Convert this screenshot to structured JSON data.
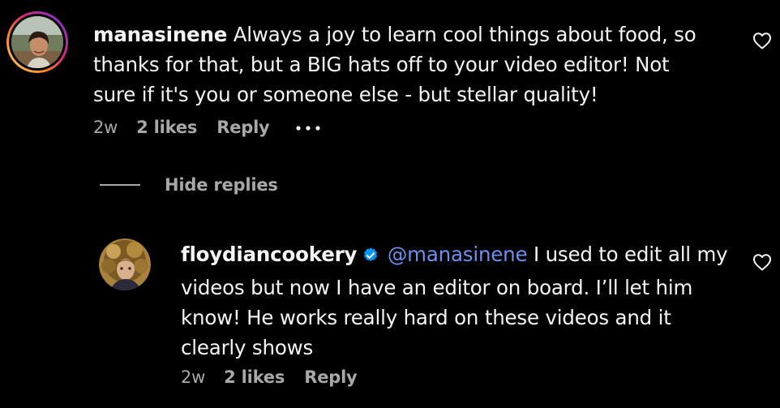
{
  "comments": [
    {
      "username": "manasinene",
      "text_lines": [
        "Always a joy to learn cool things about food, so",
        "thanks for that, but a BIG hats off to your video editor! Not",
        "sure if it's you or someone else - but stellar quality!"
      ],
      "age": "2w",
      "likes": "2 likes",
      "reply_label": "Reply",
      "more_label": "•••",
      "avatar_icon": "profile-photo-with-story-ring",
      "heart_icon": "heart-outline-icon"
    }
  ],
  "replies_toggle": {
    "label": "Hide replies"
  },
  "replies": [
    {
      "username": "floydiancookery",
      "verified": true,
      "mention": "@manasinene",
      "text_lines": [
        "I used to edit all my",
        "videos but now I have an editor on board. I’ll let him",
        "know! He works really hard on these videos and it",
        "clearly shows"
      ],
      "age": "2w",
      "likes": "2 likes",
      "reply_label": "Reply",
      "avatar_icon": "profile-photo",
      "heart_icon": "heart-outline-icon"
    }
  ],
  "colors": {
    "background": "#000000",
    "text": "#f5f5f5",
    "muted": "#a8a8a8",
    "mention": "#6d8ff0",
    "verified": "#0095f6"
  }
}
